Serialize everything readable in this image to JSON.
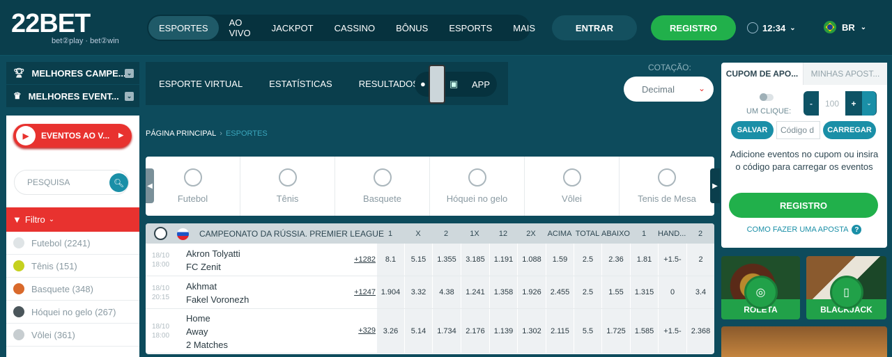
{
  "brand": {
    "logo_main": "22BET",
    "logo_sub": "bet②play · bet②win"
  },
  "nav": {
    "items": [
      "ESPORTES",
      "AO VIVO",
      "JACKPOT",
      "CASSINO",
      "BÔNUS",
      "ESPORTS",
      "MAIS"
    ],
    "active": "ESPORTES"
  },
  "header": {
    "login_label": "ENTRAR",
    "register_label": "REGISTRO",
    "time": "12:34",
    "lang": "BR"
  },
  "left": {
    "top_champ": "MELHORES CAMPE...",
    "top_events": "MELHORES EVENT...",
    "live_label": "EVENTOS AO V...",
    "search_placeholder": "PESQUISA",
    "filter_label": "Filtro",
    "sports": [
      {
        "label": "Futebol (2241)",
        "icon": "soccer-ball-icon",
        "color": "#dfe4e6"
      },
      {
        "label": "Tênis (151)",
        "icon": "tennis-ball-icon",
        "color": "#c5d11f"
      },
      {
        "label": "Basquete (348)",
        "icon": "basketball-icon",
        "color": "#d9692b"
      },
      {
        "label": "Hóquei no gelo (267)",
        "icon": "ice-hockey-icon",
        "color": "#4b565b"
      },
      {
        "label": "Vôlei (361)",
        "icon": "volleyball-icon",
        "color": "#c7cdd0"
      }
    ]
  },
  "subnav": {
    "items": [
      "ESPORTE VIRTUAL",
      "ESTATÍSTICAS",
      "RESULTADOS"
    ],
    "app_label": "APP"
  },
  "odds_format": {
    "label": "COTAÇÃO:",
    "value": "Decimal"
  },
  "breadcrumb": {
    "home": "PÁGINA PRINCIPAL",
    "current": "ESPORTES"
  },
  "sport_tiles": [
    {
      "label": "Futebol",
      "icon": "soccer-ball-icon"
    },
    {
      "label": "Tênis",
      "icon": "tennis-racket-icon"
    },
    {
      "label": "Basquete",
      "icon": "basketball-icon"
    },
    {
      "label": "Hóquei no gelo",
      "icon": "ice-hockey-icon"
    },
    {
      "label": "Vôlei",
      "icon": "volleyball-icon"
    },
    {
      "label": "Tenis de Mesa",
      "icon": "table-tennis-icon"
    }
  ],
  "league": {
    "title": "CAMPEONATO DA RÚSSIA. PREMIER LEAGUE",
    "columns": [
      "1",
      "X",
      "2",
      "1X",
      "12",
      "2X",
      "ACIMA",
      "TOTAL",
      "ABAIXO",
      "1",
      "HAND...",
      "2"
    ]
  },
  "matches": [
    {
      "date": "18/10",
      "time": "18:00",
      "teams": [
        "Akron Tolyatti",
        "FC Zenit"
      ],
      "more": "+1282",
      "odds": [
        "8.1",
        "5.15",
        "1.355",
        "3.185",
        "1.191",
        "1.088",
        "1.59",
        "2.5",
        "2.36",
        "1.81",
        "+1.5-",
        "2"
      ]
    },
    {
      "date": "18/10",
      "time": "20:15",
      "teams": [
        "Akhmat",
        "Fakel Voronezh"
      ],
      "more": "+1247",
      "odds": [
        "1.904",
        "3.32",
        "4.38",
        "1.241",
        "1.358",
        "1.926",
        "2.455",
        "2.5",
        "1.55",
        "1.315",
        "0",
        "3.4"
      ]
    },
    {
      "date": "18/10",
      "time": "18:00",
      "teams": [
        "Home",
        "Away",
        "2 Matches"
      ],
      "more": "+329",
      "odds": [
        "3.26",
        "5.14",
        "1.734",
        "2.176",
        "1.139",
        "1.302",
        "2.115",
        "5.5",
        "1.725",
        "1.585",
        "+1.5-",
        "2.368"
      ]
    }
  ],
  "coupon": {
    "tab_active": "CUPOM DE APO...",
    "tab_other": "MINHAS APOST...",
    "one_click": "UM CLIQUE:",
    "stake": "100",
    "save": "SALVAR",
    "code_placeholder": "Código d",
    "load": "CARREGAR",
    "message": "Adicione eventos no cupom ou insira o código para carregar os eventos",
    "register": "REGISTRO",
    "how_to": "COMO FAZER UMA APOSTA"
  },
  "promos": [
    {
      "label": "ROLETA"
    },
    {
      "label": "BLACKJACK"
    }
  ]
}
